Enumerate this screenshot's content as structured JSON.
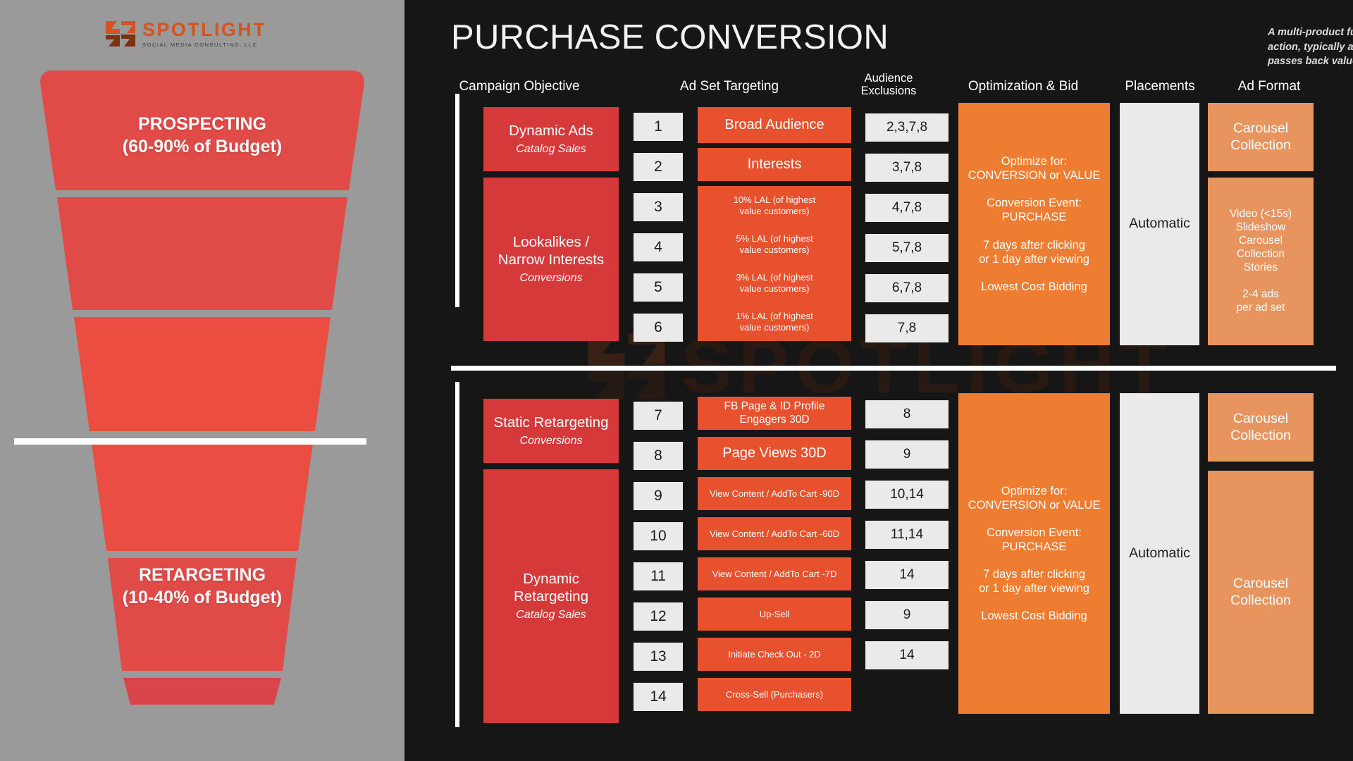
{
  "brand": {
    "logo_word": "SPOTLIGHT",
    "logo_tagline": "SOCIAL MEDIA CONSULTING, LLC",
    "watermark_word": "SPOTLIGHT",
    "accent_orange": "#d4541f",
    "red": "#d6393a",
    "orange_red": "#e8512e",
    "orange": "#ee7c31",
    "light_orange": "#e8945f",
    "panel_gray": "#9a9a9a",
    "panel_dark": "#161616"
  },
  "funnel": {
    "top_label_title": "PROSPECTING",
    "top_label_sub": "(60-90% of Budget)",
    "bottom_label_title": "RETARGETING",
    "bottom_label_sub": "(10-40% of Budget)"
  },
  "header": {
    "title": "PURCHASE CONVERSION",
    "description": "A multi-product full-funnel strategy with the ultimate action, typically a purchase, taken on the website that passes back value."
  },
  "columns": [
    {
      "label": "Campaign Objective"
    },
    {
      "label": "Ad Set Targeting"
    },
    {
      "label": "Audience\nExclusions",
      "line1": "Audience",
      "line2": "Exclusions"
    },
    {
      "label": "Optimization & Bid"
    },
    {
      "label": "Placements"
    },
    {
      "label": "Ad Format"
    }
  ],
  "prospecting": {
    "objectives": [
      {
        "title": "Dynamic Ads",
        "sub": "Catalog Sales"
      },
      {
        "title": "Lookalikes /\nNarrow Interests",
        "title_line1": "Lookalikes /",
        "title_line2": "Narrow Interests",
        "sub": "Conversions"
      }
    ],
    "numbers": [
      "1",
      "2",
      "3",
      "4",
      "5",
      "6"
    ],
    "targets": [
      {
        "text": "Broad Audience",
        "size": "lg"
      },
      {
        "text": "Interests",
        "size": "lg"
      },
      {
        "line1": "10% LAL (of highest",
        "line2": "value customers)",
        "size": "sm"
      },
      {
        "line1": "5% LAL (of highest",
        "line2": "value customers)",
        "size": "sm"
      },
      {
        "line1": "3% LAL (of highest",
        "line2": "value customers)",
        "size": "sm"
      },
      {
        "line1": "1% LAL (of highest",
        "line2": "value customers)",
        "size": "sm"
      }
    ],
    "exclusions": [
      "2,3,7,8",
      "3,7,8",
      "4,7,8",
      "5,7,8",
      "6,7,8",
      "7,8"
    ],
    "optimization": [
      "Optimize for:",
      "CONVERSION or VALUE",
      "Conversion Event:",
      "PURCHASE",
      "7 days after clicking",
      "or 1 day after viewing",
      "Lowest Cost Bidding"
    ],
    "placement": "Automatic",
    "ad_formats": [
      {
        "lines": [
          "Carousel",
          "Collection"
        ],
        "size": "lg"
      },
      {
        "lines": [
          "Video (<15s)",
          "Slideshow",
          "Carousel",
          "Collection",
          "Stories",
          "",
          "2-4 ads",
          "per ad set"
        ],
        "size": "md"
      }
    ]
  },
  "retargeting": {
    "objectives": [
      {
        "title": "Static Retargeting",
        "sub": "Conversions"
      },
      {
        "title": "Dynamic\nRetargeting",
        "title_line1": "Dynamic",
        "title_line2": "Retargeting",
        "sub": "Catalog Sales"
      }
    ],
    "numbers": [
      "7",
      "8",
      "9",
      "10",
      "11",
      "12",
      "13",
      "14"
    ],
    "targets": [
      {
        "line1": "FB Page & ID Profile",
        "line2": "Engagers 30D",
        "size": "md"
      },
      {
        "text": "Page Views 30D",
        "size": "lg"
      },
      {
        "text": "View Content / AddTo Cart -90D",
        "size": "md"
      },
      {
        "text": "View Content / AddTo Cart -60D",
        "size": "md"
      },
      {
        "text": "View Content / AddTo Cart -7D",
        "size": "md"
      },
      {
        "text": "Up-Sell",
        "size": "md"
      },
      {
        "text": "Initiate Check Out - 2D",
        "size": "md"
      },
      {
        "text": "Cross-Sell (Purchasers)",
        "size": "md"
      }
    ],
    "exclusions": [
      "8",
      "9",
      "10,14",
      "11,14",
      "14",
      "9",
      "14"
    ],
    "optimization": [
      "Optimize for:",
      "CONVERSION or VALUE",
      "Conversion Event:",
      "PURCHASE",
      "7 days after clicking",
      "or 1 day after viewing",
      "Lowest Cost Bidding"
    ],
    "placement": "Automatic",
    "ad_formats": [
      {
        "lines": [
          "Carousel",
          "Collection"
        ],
        "size": "lg"
      },
      {
        "lines": [
          "Carousel",
          "Collection"
        ],
        "size": "lg"
      }
    ]
  }
}
